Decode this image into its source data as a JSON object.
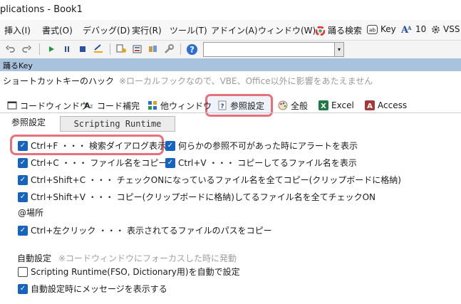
{
  "title": "plications - Book1",
  "menu": [
    {
      "label": "挿入(I)"
    },
    {
      "label": "書式(O)"
    },
    {
      "label": "デバッグ(D)"
    },
    {
      "label": "実行(R)"
    },
    {
      "label": "ツール(T)"
    },
    {
      "label": "アドイン(A)"
    },
    {
      "label": "ウィンドウ(W)"
    },
    {
      "label": "踊る検索",
      "icon": "color-wheel-icon"
    },
    {
      "label": "Key",
      "icon": "ab-icon"
    },
    {
      "label": "10",
      "icon": "font-size-icon"
    },
    {
      "label": "VSS",
      "icon": "gear-icon"
    }
  ],
  "toolbar": {
    "icons": [
      "undo-icon",
      "redo-icon",
      "run-icon",
      "pause-icon",
      "stop-icon",
      "design-mode-icon",
      "project-explorer-icon",
      "properties-icon",
      "object-browser-icon",
      "toolbox-icon",
      "help-icon"
    ],
    "combo_value": ""
  },
  "panel": {
    "title": "踊るKey"
  },
  "hook": {
    "label": "ショートカットキーのハック",
    "note": "※ローカルフックなので、VBE、Office以外に影響をあたえません"
  },
  "tabs": [
    {
      "label": "コードウィンドウ",
      "icon": "code-window-icon"
    },
    {
      "label": "コード補完",
      "icon": "code-complete-icon"
    },
    {
      "label": "他ウィンドウ",
      "icon": "windows-grid-icon"
    },
    {
      "label": "参照設定",
      "icon": "reference-icon",
      "selected": true
    },
    {
      "label": "全般",
      "icon": "palette-icon"
    },
    {
      "label": "Excel",
      "icon": "excel-icon"
    },
    {
      "label": "Access",
      "icon": "access-icon"
    }
  ],
  "reference": {
    "label": "参照設定",
    "scripting_button": "Scripting Runtime",
    "options": [
      {
        "label": "Ctrl+F ・・・ 検索ダイアログ表示",
        "checked": true
      },
      {
        "label": "何らかの参照不可があった時にアラートを表示",
        "checked": true
      },
      {
        "label": "Ctrl+C ・・・ ファイル名をコピー",
        "checked": true
      },
      {
        "label": "Ctrl+V ・・・ コピーしてるファイル名を表示",
        "checked": true
      },
      {
        "label": "Ctrl+Shift+C ・・・ チェックONになっているファイル名を全てコピー(クリップボードに格納)",
        "checked": true
      },
      {
        "label": "Ctrl+Shift+V ・・・ コピー(クリップボードに格納)してるファイル名を全てチェックON",
        "checked": true
      }
    ],
    "place_label": "@場所",
    "place_option": {
      "label": "Ctrl+左クリック ・・・ 表示されてるファイルのパスをコピー",
      "checked": true
    }
  },
  "auto": {
    "label": "自動設定",
    "note": "※コードウィンドウにフォーカスした時に発動",
    "options": [
      {
        "label": "Scripting Runtime(FSO, Dictionary用)を自動で設定",
        "checked": false
      },
      {
        "label": "自動設定時にメッセージを表示する",
        "checked": true
      }
    ]
  },
  "colors": {
    "accent": "#1565c0",
    "highlight": "#e8707a",
    "panel_header": "#a9c3de"
  }
}
